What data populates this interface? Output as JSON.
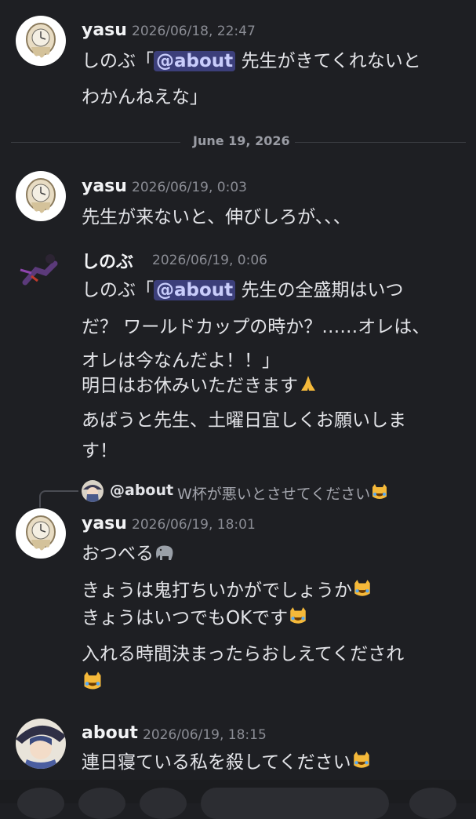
{
  "divider": {
    "date": "June 19, 2026"
  },
  "messages": [
    {
      "author": "yasu",
      "timestamp": "2026/06/18, 22:47",
      "line1_pre": "しのぶ「",
      "line1_mention": "@about",
      "line1_post": " 先生がきてくれないと",
      "line2": "わかんねえな」"
    },
    {
      "author": "yasu",
      "timestamp": "2026/06/19, 0:03",
      "line1": "先生が来ないと、伸びしろが、、、"
    },
    {
      "author": "しのぶ",
      "timestamp": "2026/06/19, 0:06",
      "line1_pre": "しのぶ「",
      "line1_mention": "@about",
      "line1_post": " 先生の全盛期はいつ",
      "line2": "だ？ ワールドカップの時か？……オレは、",
      "line3": "オレは今なんだよ！！」",
      "line4": "明日はお休みいただきます",
      "line5": "あばうと先生、土曜日宜しくお願いしま",
      "line6": "す！"
    },
    {
      "author": "yasu",
      "timestamp": "2026/06/19, 18:01",
      "reply_name": "@about",
      "reply_text": "W杯が悪いとさせてください",
      "line1": "おつべる",
      "line2": "きょうは鬼打ちいかがでしょうか",
      "line3": "きょうはいつでもOKです",
      "line4": "入れる時間決まったらおしえてくだされ"
    },
    {
      "author": "about",
      "timestamp": "2026/06/19, 18:15",
      "line1": "連日寝ている私を殺してください"
    }
  ],
  "icons": {
    "pray": "folded-hands-icon",
    "elephant": "elephant-icon",
    "laugh": "laughing-cat-icon"
  }
}
